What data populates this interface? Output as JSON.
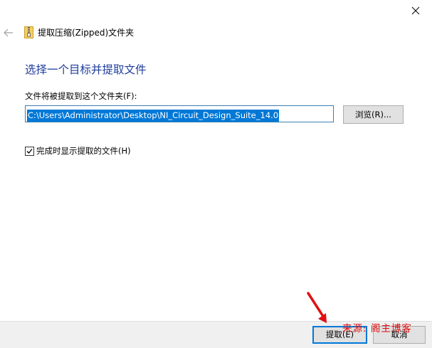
{
  "window": {
    "title": "提取压缩(Zipped)文件夹"
  },
  "main": {
    "heading": "选择一个目标并提取文件",
    "path_label": "文件将被提取到这个文件夹(F):",
    "path_value": "C:\\Users\\Administrator\\Desktop\\NI_Circuit_Design_Suite_14.0",
    "browse_label": "浏览(R)...",
    "checkbox_label": "完成时显示提取的文件(H)",
    "checkbox_checked": true
  },
  "footer": {
    "extract_label": "提取(E)",
    "cancel_label": "取消"
  },
  "overlay": {
    "watermark": "来源: 阁主博客"
  },
  "icons": {
    "close": "close-icon",
    "back": "back-arrow-icon",
    "zip": "zip-folder-icon",
    "check": "checkmark-icon",
    "annotation": "red-arrow-annotation"
  },
  "colors": {
    "heading": "#1e3c9c",
    "accent": "#0078d7",
    "footer_bg": "#f0f0f0",
    "annotation": "#e01010"
  }
}
